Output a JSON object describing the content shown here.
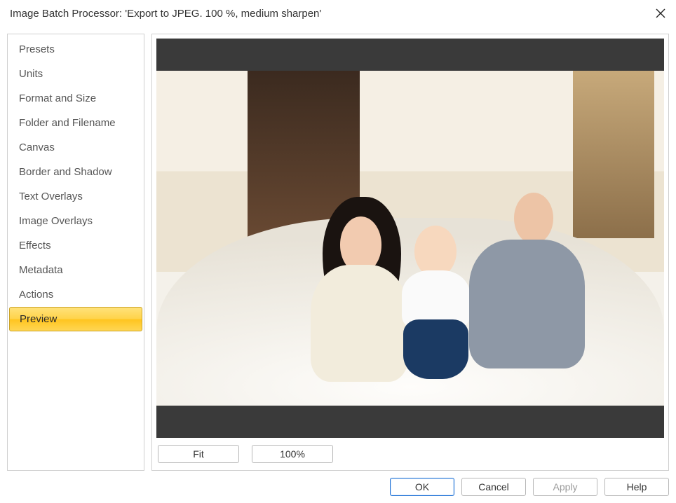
{
  "window": {
    "title": "Image Batch Processor: 'Export to JPEG. 100 %, medium sharpen'"
  },
  "sidebar": {
    "items": [
      {
        "label": "Presets"
      },
      {
        "label": "Units"
      },
      {
        "label": "Format and Size"
      },
      {
        "label": "Folder and Filename"
      },
      {
        "label": "Canvas"
      },
      {
        "label": "Border and Shadow"
      },
      {
        "label": "Text Overlays"
      },
      {
        "label": "Image Overlays"
      },
      {
        "label": "Effects"
      },
      {
        "label": "Metadata"
      },
      {
        "label": "Actions"
      },
      {
        "label": "Preview"
      }
    ],
    "selected_index": 11
  },
  "preview": {
    "zoom": {
      "fit": "Fit",
      "p100": "100%"
    }
  },
  "footer": {
    "ok": "OK",
    "cancel": "Cancel",
    "apply": "Apply",
    "help": "Help"
  }
}
